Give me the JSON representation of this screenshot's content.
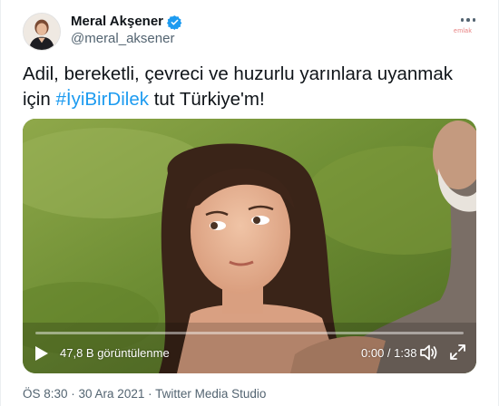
{
  "author": {
    "display_name": "Meral Akşener",
    "handle": "@meral_aksener",
    "verified": true
  },
  "watermark": "emlak",
  "tweet": {
    "text_before": "Adil, bereketli, çevreci ve huzurlu yarınlara uyanmak için ",
    "hashtag": "#İyiBirDilek",
    "text_after": " tut Türkiye'm!"
  },
  "video": {
    "views": "47,8 B görüntülenme",
    "time": "0:00 / 1:38",
    "progress": 0
  },
  "meta": {
    "time": "ÖS 8:30",
    "separator1": " · ",
    "date": "30 Ara 2021",
    "separator2": " · ",
    "source": "Twitter Media Studio"
  },
  "colors": {
    "accent": "#1d9bf0",
    "secondary_text": "#536471"
  },
  "icons": [
    "more-icon",
    "verified-badge-icon",
    "play-icon",
    "volume-icon",
    "fullscreen-icon"
  ]
}
